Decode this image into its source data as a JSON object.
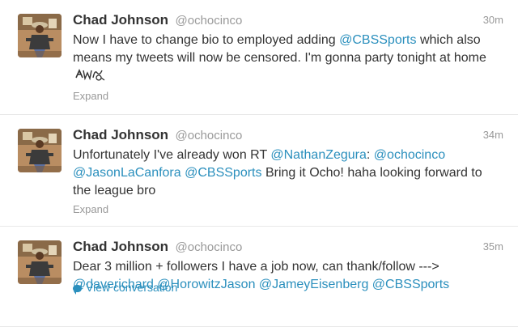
{
  "tweets": [
    {
      "name": "Chad Johnson",
      "handle": "@ochocinco",
      "time": "30m",
      "segments": [
        {
          "text": "Now I have to change bio to employed adding ",
          "type": "text"
        },
        {
          "text": "@CBSSports",
          "type": "mention"
        },
        {
          "text": " which also means my tweets will now be censored. I'm gonna party tonight at home",
          "type": "text"
        }
      ],
      "emoji": "party-emoji-icon",
      "action": "Expand"
    },
    {
      "name": "Chad Johnson",
      "handle": "@ochocinco",
      "time": "34m",
      "segments": [
        {
          "text": "Unfortunately I've already won RT ",
          "type": "text"
        },
        {
          "text": "@NathanZegura",
          "type": "mention"
        },
        {
          "text": ": ",
          "type": "text"
        },
        {
          "text": "@ochocinco",
          "type": "mention"
        },
        {
          "text": " ",
          "type": "text"
        },
        {
          "text": "@JasonLaCanfora",
          "type": "mention"
        },
        {
          "text": " ",
          "type": "text"
        },
        {
          "text": "@CBSSports",
          "type": "mention"
        },
        {
          "text": " Bring it Ocho! haha looking forward to the league bro",
          "type": "text"
        }
      ],
      "action": "Expand"
    },
    {
      "name": "Chad Johnson",
      "handle": "@ochocinco",
      "time": "35m",
      "segments": [
        {
          "text": "Dear 3 million + followers I have a job now, can thank/follow ---> ",
          "type": "text"
        },
        {
          "text": "@daverichard",
          "type": "mention"
        },
        {
          "text": " ",
          "type": "text"
        },
        {
          "text": "@HorowitzJason",
          "type": "mention"
        },
        {
          "text": " ",
          "type": "text"
        },
        {
          "text": "@JameyEisenberg",
          "type": "mention"
        },
        {
          "text": " ",
          "type": "text"
        },
        {
          "text": "@CBSSports",
          "type": "mention"
        }
      ],
      "action": "View conversation",
      "action_icon": "conversation-bubble-icon"
    }
  ],
  "colors": {
    "link": "#2a8fbd",
    "muted": "#999999",
    "text": "#333333"
  }
}
